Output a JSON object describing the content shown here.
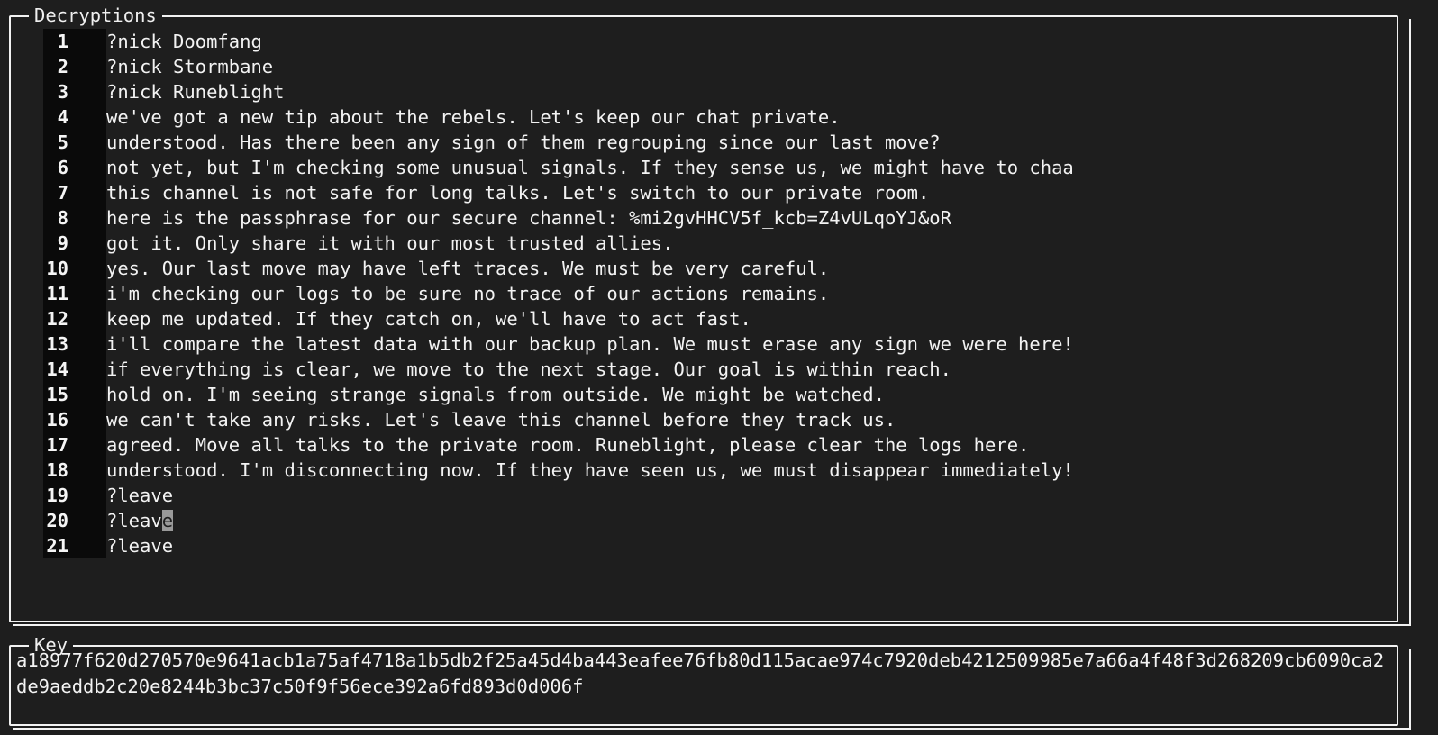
{
  "decryptions": {
    "title": "Decryptions",
    "lines": [
      {
        "num": "1",
        "text": "?nick Doomfang"
      },
      {
        "num": "2",
        "text": "?nick Stormbane"
      },
      {
        "num": "3",
        "text": "?nick Runeblight"
      },
      {
        "num": "4",
        "text": "we've got a new tip about the rebels. Let's keep our chat private."
      },
      {
        "num": "5",
        "text": "understood. Has there been any sign of them regrouping since our last move?"
      },
      {
        "num": "6",
        "text": "not yet, but I'm checking some unusual signals. If they sense us, we might have to chaa"
      },
      {
        "num": "7",
        "text": "this channel is not safe for long talks. Let's switch to our private room."
      },
      {
        "num": "8",
        "text": "here is the passphrase for our secure channel: %mi2gvHHCV5f_kcb=Z4vULqoYJ&oR"
      },
      {
        "num": "9",
        "text": "got it. Only share it with our most trusted allies."
      },
      {
        "num": "10",
        "text": "yes. Our last move may have left traces. We must be very careful."
      },
      {
        "num": "11",
        "text": "i'm checking our logs to be sure no trace of our actions remains."
      },
      {
        "num": "12",
        "text": "keep me updated. If they catch on, we'll have to act fast."
      },
      {
        "num": "13",
        "text": "i'll compare the latest data with our backup plan. We must erase any sign we were here!"
      },
      {
        "num": "14",
        "text": "if everything is clear, we move to the next stage. Our goal is within reach."
      },
      {
        "num": "15",
        "text": "hold on. I'm seeing strange signals from outside. We might be watched."
      },
      {
        "num": "16",
        "text": "we can't take any risks. Let's leave this channel before they track us."
      },
      {
        "num": "17",
        "text": "agreed. Move all talks to the private room. Runeblight, please clear the logs here."
      },
      {
        "num": "18",
        "text": "understood. I'm disconnecting now. If they have seen us, we must disappear immediately!"
      },
      {
        "num": "19",
        "text": "?leave"
      },
      {
        "num": "20",
        "text_before_cursor": "?leav",
        "cursor_char": "e",
        "text_after_cursor": ""
      },
      {
        "num": "21",
        "text": "?leave"
      }
    ]
  },
  "key": {
    "title": "Key",
    "value": "a18977f620d270570e9641acb1a75af4718a1b5db2f25a45d4ba443eafee76fb80d115acae974c7920deb4212509985e7a66a4f48f3d268209cb6090ca2de9aeddb2c20e8244b3bc37c50f9f56ece392a6fd893d0d006f"
  },
  "colors": {
    "background": "#1e1e1e",
    "border": "#f2f2f2",
    "text": "#f3f3f3",
    "gutter": "#0a0a0a",
    "cursor": "#9a9a9a"
  }
}
